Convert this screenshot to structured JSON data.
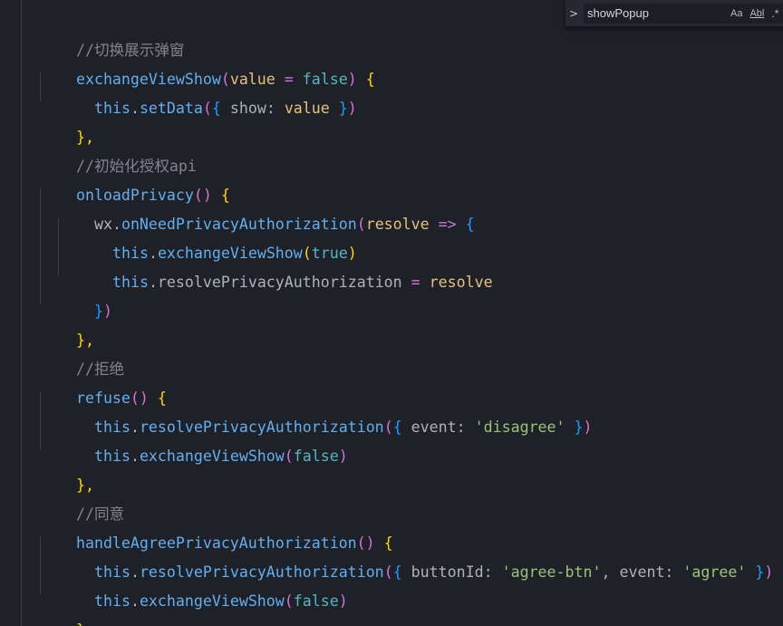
{
  "find": {
    "toggle_glyph": ">",
    "query": "showPopup",
    "match_case_label": "Aa",
    "whole_word_label": "Abl",
    "regex_label": ".*"
  },
  "code": {
    "line0": "//切换展示弹窗",
    "line1_name": "exchangeViewShow",
    "line1_paren_open": "(",
    "line1_param": "value",
    "line1_eq": " = ",
    "line1_val": "false",
    "line1_paren_close": ")",
    "line1_brace": " {",
    "line2_this": "this",
    "line2_dot": ".",
    "line2_method": "setData",
    "line2_paren_open": "(",
    "line2_brace_open": "{",
    "line2_key": " show: ",
    "line2_value": "value",
    "line2_brace_close": " }",
    "line2_paren_close": ")",
    "line3": "},",
    "line4": "//初始化授权api",
    "line5_name": "onloadPrivacy",
    "line5_parens": "()",
    "line5_brace": " {",
    "line6_obj": "wx",
    "line6_dot": ".",
    "line6_method": "onNeedPrivacyAuthorization",
    "line6_paren_open": "(",
    "line6_param": "resolve",
    "line6_arrow": " => ",
    "line6_brace": "{",
    "line7_this": "this",
    "line7_dot": ".",
    "line7_method": "exchangeViewShow",
    "line7_paren_open": "(",
    "line7_val": "true",
    "line7_paren_close": ")",
    "line8_this": "this",
    "line8_prop": ".resolvePrivacyAuthorization",
    "line8_eq": " = ",
    "line8_val": "resolve",
    "line9_brace": "}",
    "line9_paren": ")",
    "line10": "},",
    "line11": "//拒绝",
    "line12_name": "refuse",
    "line12_parens": "()",
    "line12_brace": " {",
    "line13_this": "this",
    "line13_dot": ".",
    "line13_method": "resolvePrivacyAuthorization",
    "line13_paren_open": "(",
    "line13_brace_open": "{",
    "line13_key": " event: ",
    "line13_str": "'disagree'",
    "line13_brace_close": " }",
    "line13_paren_close": ")",
    "line14_this": "this",
    "line14_dot": ".",
    "line14_method": "exchangeViewShow",
    "line14_paren_open": "(",
    "line14_val": "false",
    "line14_paren_close": ")",
    "line15": "},",
    "line16": "//同意",
    "line17_name": "handleAgreePrivacyAuthorization",
    "line17_parens": "()",
    "line17_brace": " {",
    "line18_this": "this",
    "line18_dot": ".",
    "line18_method": "resolvePrivacyAuthorization",
    "line18_paren_open": "(",
    "line18_brace_open": "{",
    "line18_key1": " buttonId: ",
    "line18_str1": "'agree-btn'",
    "line18_comma": ", event: ",
    "line18_str2": "'agree'",
    "line18_brace_close": " }",
    "line18_paren_close": ")",
    "line19_this": "this",
    "line19_dot": ".",
    "line19_method": "exchangeViewShow",
    "line19_paren_open": "(",
    "line19_val": "false",
    "line19_paren_close": ")",
    "line20": "},"
  },
  "colors": {
    "background": "#1f2129",
    "comment": "#7f848e",
    "function": "#61afef",
    "string": "#98c379",
    "keyword": "#56b6c2"
  }
}
